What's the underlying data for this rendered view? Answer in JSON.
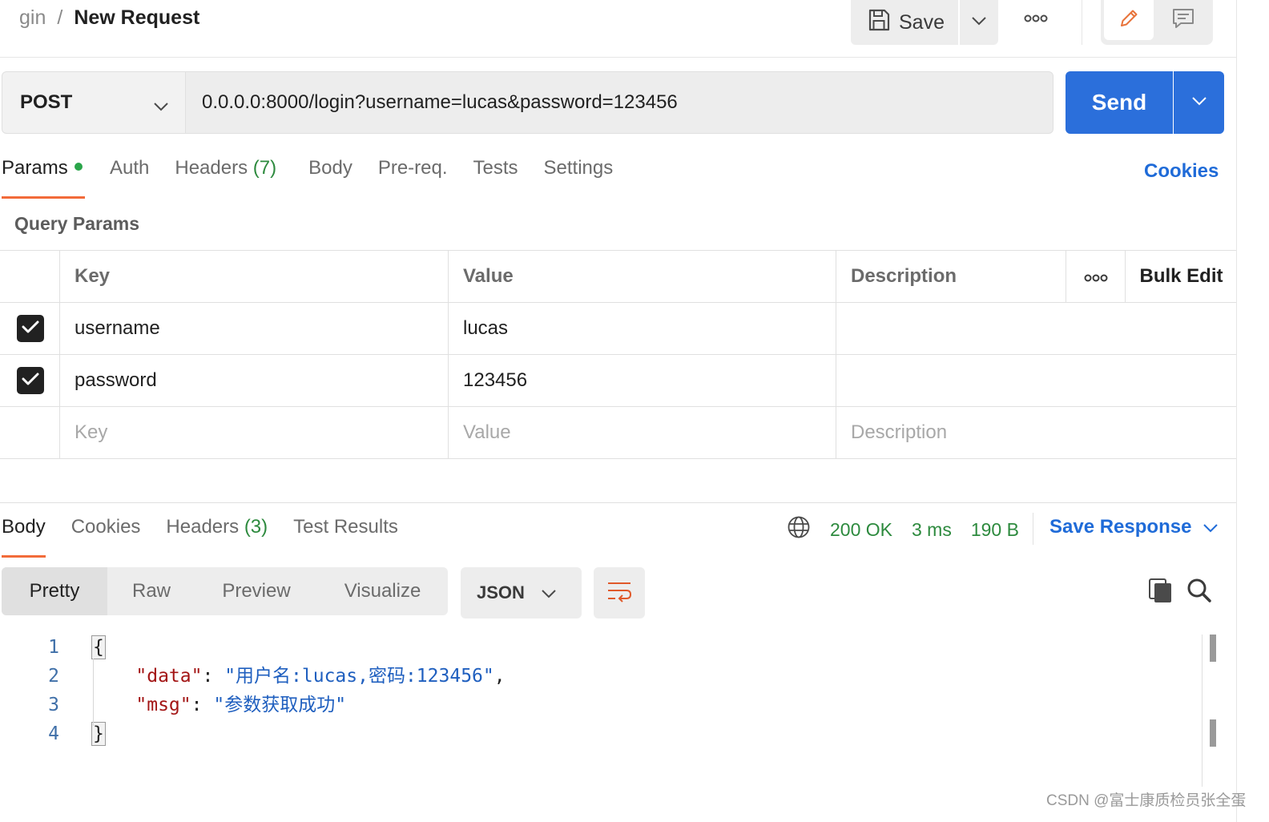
{
  "header": {
    "collection": "gin",
    "separator": "/",
    "title": "New Request",
    "save_label": "Save"
  },
  "request": {
    "method": "POST",
    "url": "0.0.0.0:8000/login?username=lucas&password=123456",
    "send_label": "Send"
  },
  "request_tabs": {
    "params": "Params",
    "auth": "Auth",
    "headers": "Headers",
    "headers_count": "(7)",
    "body": "Body",
    "prereq": "Pre-req.",
    "tests": "Tests",
    "settings": "Settings",
    "cookies": "Cookies"
  },
  "query_params": {
    "title": "Query Params",
    "columns": {
      "key": "Key",
      "value": "Value",
      "description": "Description",
      "bulk_edit": "Bulk Edit"
    },
    "rows": [
      {
        "checked": true,
        "key": "username",
        "value": "lucas",
        "description": ""
      },
      {
        "checked": true,
        "key": "password",
        "value": "123456",
        "description": ""
      }
    ],
    "placeholders": {
      "key": "Key",
      "value": "Value",
      "description": "Description"
    }
  },
  "response_tabs": {
    "body": "Body",
    "cookies": "Cookies",
    "headers": "Headers",
    "headers_count": "(3)",
    "test_results": "Test Results"
  },
  "response_status": {
    "status": "200 OK",
    "time": "3 ms",
    "size": "190 B",
    "save_response": "Save Response"
  },
  "view": {
    "modes": [
      "Pretty",
      "Raw",
      "Preview",
      "Visualize"
    ],
    "active_mode": "Pretty",
    "format": "JSON"
  },
  "code": {
    "line_numbers": [
      "1",
      "2",
      "3",
      "4"
    ],
    "open_brace": "{",
    "close_brace": "}",
    "data_key": "\"data\"",
    "data_value": "\"用户名:lucas,密码:123456\"",
    "msg_key": "\"msg\"",
    "msg_value": "\"参数获取成功\""
  },
  "watermark": "CSDN @富士康质检员张全蛋",
  "colors": {
    "accent": "#2b6fdb",
    "tab_underline": "#f26b3a",
    "status_ok": "#2d8a3e",
    "link": "#1f6bd8",
    "json_key": "#a31515",
    "json_string": "#1f5fbf"
  }
}
